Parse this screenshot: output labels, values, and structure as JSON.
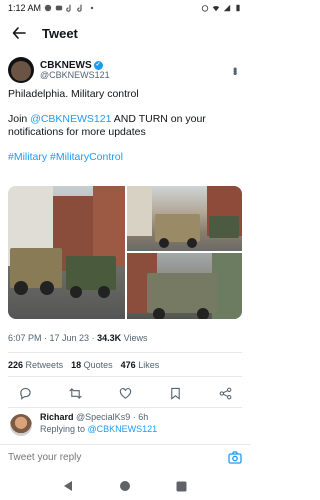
{
  "status_bar": {
    "time": "1:12 AM",
    "left_icons": [
      "messenger-icon",
      "chat-icon",
      "tiktok-icon",
      "tiktok-icon",
      "dot-icon"
    ],
    "right_icons": [
      "alarm-icon",
      "wifi-icon",
      "signal-icon",
      "battery-icon"
    ]
  },
  "header": {
    "title": "Tweet",
    "back_icon": "back-arrow-icon"
  },
  "author": {
    "name": "CBKNEWS",
    "handle": "@CBKNEWS121",
    "verified": true
  },
  "tweet": {
    "line1": "Philadelphia. Military control",
    "line2_prefix": "Join ",
    "line2_link": "@CBKNEWS121",
    "line2_suffix": " AND TURN on your notifications for more updates",
    "hashtag1": "#Military",
    "hashtag2": "#MilitaryControl"
  },
  "meta": {
    "time": "6:07 PM",
    "date": "17 Jun 23",
    "views_count": "34.3K",
    "views_label": "Views"
  },
  "stats": {
    "retweets_count": "226",
    "retweets_label": "Retweets",
    "quotes_count": "18",
    "quotes_label": "Quotes",
    "likes_count": "476",
    "likes_label": "Likes"
  },
  "actions": [
    "reply-icon",
    "retweet-icon",
    "like-icon",
    "bookmark-icon",
    "share-icon"
  ],
  "reply": {
    "name": "Richard",
    "handle": "@SpecialKs9",
    "age": "6h",
    "replying_prefix": "Replying to ",
    "replying_handle": "@CBKNEWS121"
  },
  "compose": {
    "placeholder": "Tweet your reply"
  },
  "colors": {
    "accent": "#1d9bf0",
    "text": "#0f1419",
    "muted": "#536471"
  }
}
